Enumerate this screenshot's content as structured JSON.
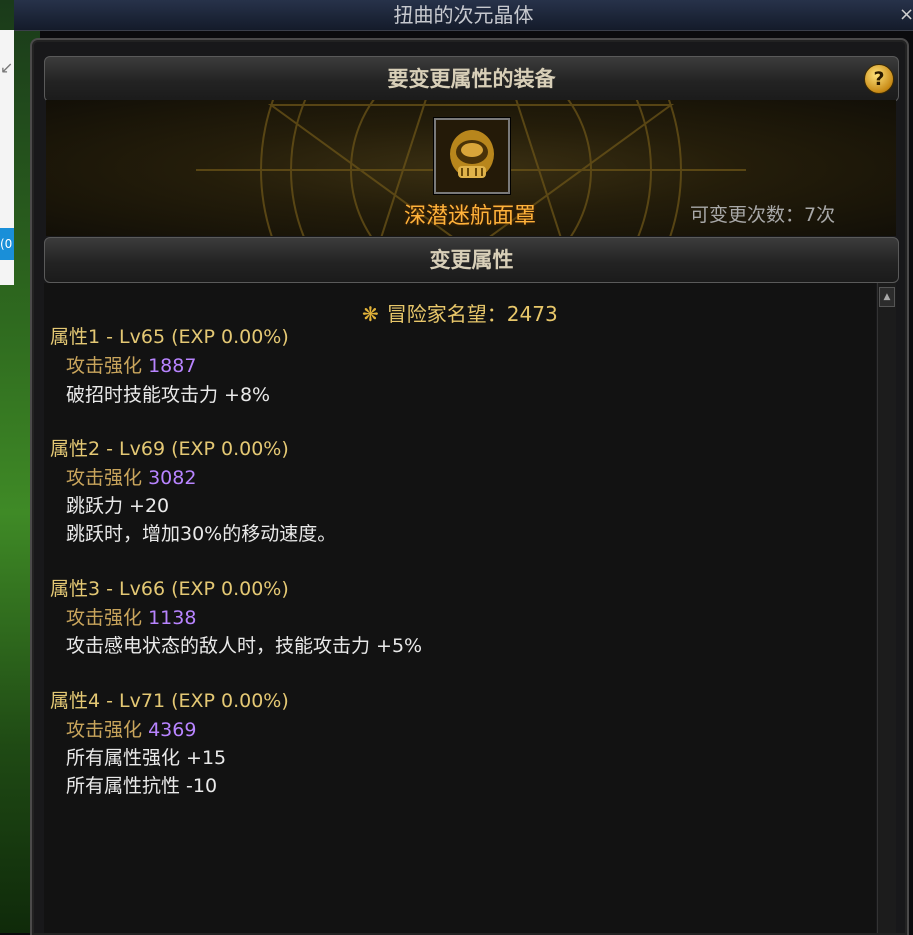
{
  "window": {
    "title": "扭曲的次元晶体",
    "close_label": "×"
  },
  "background": {
    "blue_tab_text": "(0"
  },
  "equipment_section": {
    "header": "要变更属性的装备",
    "help_label": "?",
    "item_name": "深潜迷航面罩",
    "change_count": "可变更次数：7次"
  },
  "attribute_section": {
    "header": "变更属性",
    "fame_label": "冒险家名望：2473",
    "attributes": [
      {
        "title": "属性1 - Lv65 (EXP 0.00%)",
        "enhance_label": "攻击强化",
        "enhance_value": "1887",
        "effects": [
          "破招时技能攻击力 +8%"
        ]
      },
      {
        "title": "属性2 - Lv69 (EXP 0.00%)",
        "enhance_label": "攻击强化",
        "enhance_value": "3082",
        "effects": [
          "跳跃力 +20",
          "跳跃时，增加30%的移动速度。"
        ]
      },
      {
        "title": "属性3 - Lv66 (EXP 0.00%)",
        "enhance_label": "攻击强化",
        "enhance_value": "1138",
        "effects": [
          "攻击感电状态的敌人时，技能攻击力 +5%"
        ]
      },
      {
        "title": "属性4 - Lv71 (EXP 0.00%)",
        "enhance_label": "攻击强化",
        "enhance_value": "4369",
        "effects": [
          "所有属性强化 +15",
          "所有属性抗性 -10"
        ]
      }
    ]
  },
  "colors": {
    "attribute_title": "#e4c874",
    "enhance_label": "#c9a55c",
    "enhance_value": "#b884ff",
    "effect_text": "#e9e9e9",
    "item_name": "#ffb23a"
  }
}
